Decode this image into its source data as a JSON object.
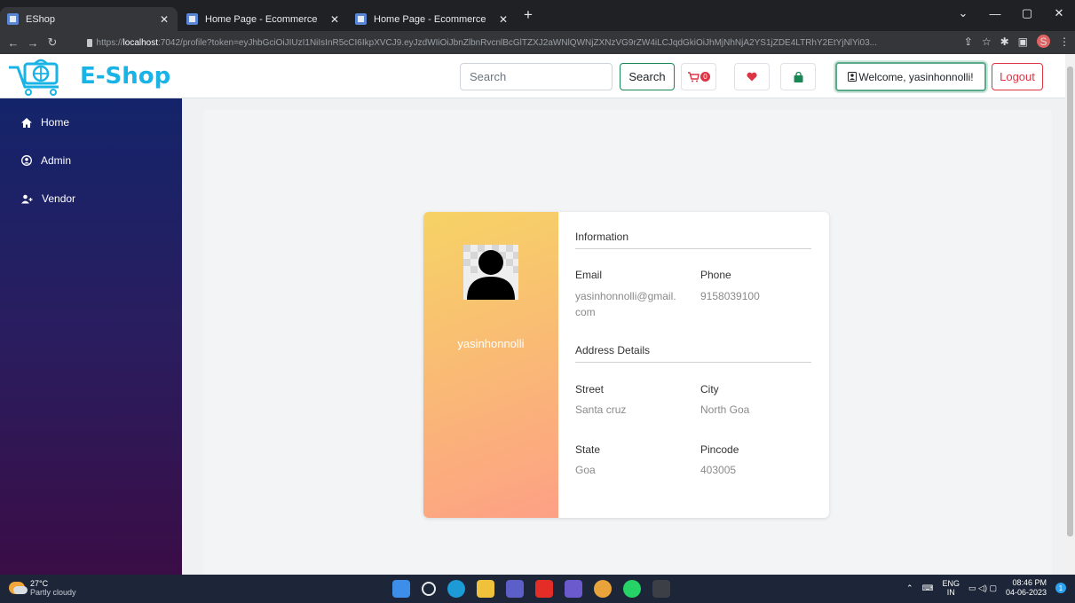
{
  "browser": {
    "tabs": [
      {
        "title": "EShop",
        "active": true
      },
      {
        "title": "Home Page - Ecommerce",
        "active": false
      },
      {
        "title": "Home Page - Ecommerce",
        "active": false
      }
    ],
    "url_prefix": "https://",
    "url_host": "localhost",
    "url_rest": ":7042/profile?token=eyJhbGciOiJIUzI1NiIsInR5cCI6IkpXVCJ9.eyJzdWIiOiJbnZlbnRvcnlBcGlTZXJ2aWNlQWNjZXNzVG9rZW4iLCJqdGkiOiJhMjNhNjA2YS1jZDE4LTRhY2EtYjNlYi03...",
    "profile_initial": "S"
  },
  "header": {
    "logo_text": "E-Shop",
    "search_placeholder": "Search",
    "search_button": "Search",
    "cart_count": "0",
    "welcome_text": "Welcome, yasinhonnolli!",
    "logout_label": "Logout"
  },
  "sidebar": {
    "items": [
      {
        "label": "Home",
        "icon": "home-icon"
      },
      {
        "label": "Admin",
        "icon": "user-circle-icon"
      },
      {
        "label": "Vendor",
        "icon": "user-plus-icon"
      }
    ]
  },
  "profile": {
    "username": "yasinhonnolli",
    "information_title": "Information",
    "email_label": "Email",
    "email_line1": "yasinhonnolli@gmail.",
    "email_line2": "com",
    "phone_label": "Phone",
    "phone_value": "9158039100",
    "address_title": "Address Details",
    "street_label": "Street",
    "street_value": "Santa cruz",
    "city_label": "City",
    "city_value": "North Goa",
    "state_label": "State",
    "state_value": "Goa",
    "pincode_label": "Pincode",
    "pincode_value": "403005"
  },
  "taskbar": {
    "temperature": "27°C",
    "weather": "Partly cloudy",
    "lang_top": "ENG",
    "lang_bottom": "IN",
    "time": "08:46 PM",
    "date": "04-06-2023",
    "notification_count": "1"
  },
  "colors": {
    "brand": "#1ab3e6",
    "sidebar_top": "#14246a",
    "sidebar_bottom": "#3a0d46",
    "card_gradient_start": "#f6d365",
    "card_gradient_end": "#fda085",
    "logout": "#dc3545",
    "search_button_border": "#198754"
  }
}
